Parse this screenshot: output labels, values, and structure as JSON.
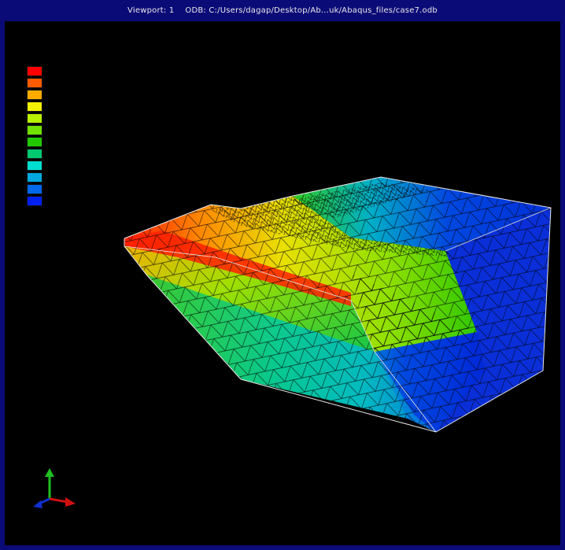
{
  "window": {
    "viewport_label": "Viewport: 1",
    "odb_label": "ODB: C:/Users/dagap/Desktop/Ab...uk/Abaqus_files/case7.odb"
  },
  "legend": {
    "colors": [
      "#ff0000",
      "#ff5a00",
      "#ffab00",
      "#f2f200",
      "#b8f000",
      "#6fe000",
      "#22c800",
      "#00c870",
      "#00dccf",
      "#00a8e0",
      "#0068ea",
      "#0020f0"
    ]
  },
  "model": {
    "description_icon": "fe-mesh-contour-plot"
  },
  "triad": {
    "axis_colors": {
      "x": "#d01010",
      "y": "#20c020",
      "z": "#1030d0"
    }
  }
}
